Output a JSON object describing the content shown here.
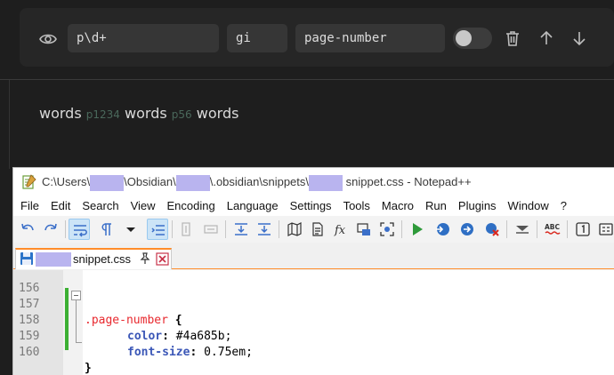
{
  "regex_panel": {
    "pattern": "p\\d+",
    "flags": "gi",
    "css_class": "page-number",
    "toggle_on": false
  },
  "preview": {
    "word1": "words",
    "num1": "p1234",
    "word2": "words",
    "num2": "p56",
    "word3": "words",
    "number_color": "#4a685b"
  },
  "notepad": {
    "title_parts": [
      "C:\\Users\\",
      "\\Obsidian\\",
      "\\.obsidian\\snippets\\",
      " snippet.css - Notepad++"
    ],
    "menu": [
      "File",
      "Edit",
      "Search",
      "View",
      "Encoding",
      "Language",
      "Settings",
      "Tools",
      "Macro",
      "Run",
      "Plugins",
      "Window",
      "?"
    ],
    "tab_label": "snippet.css",
    "line_numbers": [
      "156",
      "157",
      "158",
      "159",
      "160"
    ],
    "code": {
      "selector": ".page-number",
      "brace_open": " {",
      "prop1": "color",
      "val1": " #4a685b;",
      "prop2": "font-size",
      "val2": " 0.75em;",
      "brace_close": "}"
    }
  }
}
